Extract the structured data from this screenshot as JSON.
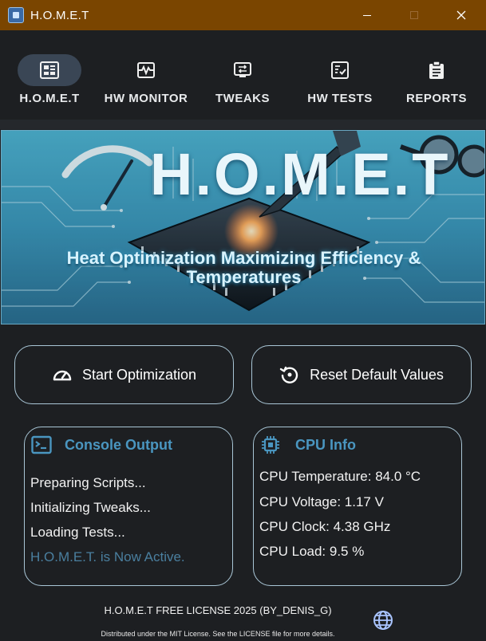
{
  "window": {
    "title": "H.O.M.E.T",
    "minimize_icon": "minimize-icon",
    "maximize_icon": "maximize-icon",
    "close_icon": "close-icon"
  },
  "nav": {
    "items": [
      {
        "label": "H.O.M.E.T",
        "icon": "dashboard-icon",
        "active": true
      },
      {
        "label": "HW MONITOR",
        "icon": "pulse-monitor-icon",
        "active": false
      },
      {
        "label": "TWEAKS",
        "icon": "tweaks-icon",
        "active": false
      },
      {
        "label": "HW TESTS",
        "icon": "checklist-icon",
        "active": false
      },
      {
        "label": "REPORTS",
        "icon": "clipboard-icon",
        "active": false
      }
    ]
  },
  "banner": {
    "title": "H.O.M.E.T",
    "subtitle_line1": "Heat Optimization Maximizing Efficiency &",
    "subtitle_line2": "Temperatures"
  },
  "actions": {
    "start_label": "Start Optimization",
    "start_icon": "speedometer-icon",
    "reset_label": "Reset Default Values",
    "reset_icon": "reset-icon"
  },
  "console": {
    "title": "Console Output",
    "icon": "terminal-icon",
    "lines": [
      "Preparing Scripts...",
      "Initializing Tweaks...",
      "Loading Tests...",
      "H.O.M.E.T. is Now Active."
    ]
  },
  "cpu": {
    "title": "CPU Info",
    "icon": "cpu-chip-icon",
    "temperature": "CPU Temperature: 84.0 °C",
    "voltage": "CPU Voltage: 1.17 V",
    "clock": "CPU Clock: 4.38 GHz",
    "load": "CPU Load: 9.5 %"
  },
  "footer": {
    "license": "H.O.M.E.T FREE LICENSE 2025 (BY_DENIS_G)",
    "note": "Distributed under the MIT License. See the LICENSE file for more details.",
    "globe_icon": "globe-icon"
  },
  "colors": {
    "titlebar": "#7a4500",
    "background": "#1d1f22",
    "accent": "#4a96c0",
    "border": "#a9c6d6",
    "active_nav": "#3a4655"
  }
}
